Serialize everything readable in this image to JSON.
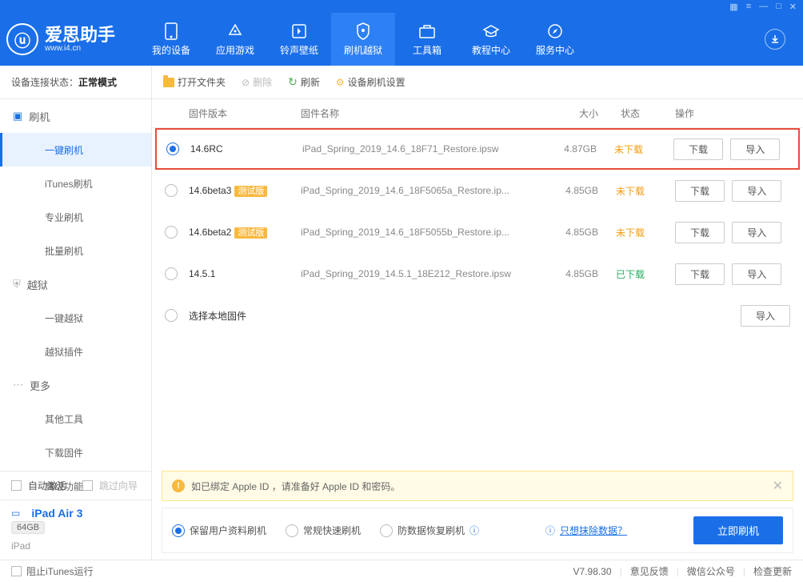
{
  "logo": {
    "title": "爱思助手",
    "sub": "www.i4.cn"
  },
  "nav": [
    {
      "label": "我的设备"
    },
    {
      "label": "应用游戏"
    },
    {
      "label": "铃声壁纸"
    },
    {
      "label": "刷机越狱"
    },
    {
      "label": "工具箱"
    },
    {
      "label": "教程中心"
    },
    {
      "label": "服务中心"
    }
  ],
  "status": {
    "label": "设备连接状态：",
    "value": "正常模式"
  },
  "toolbar": {
    "open_folder": "打开文件夹",
    "delete": "删除",
    "refresh": "刷新",
    "settings": "设备刷机设置"
  },
  "sidebar": {
    "flash": "刷机",
    "items_flash": [
      "一键刷机",
      "iTunes刷机",
      "专业刷机",
      "批量刷机"
    ],
    "jailbreak": "越狱",
    "items_jb": [
      "一键越狱",
      "越狱插件"
    ],
    "more": "更多",
    "items_more": [
      "其他工具",
      "下载固件",
      "高级功能"
    ],
    "auto_activate": "自动激活",
    "skip_wizard": "跳过向导",
    "device": "iPad Air 3",
    "storage": "64GB",
    "device_type": "iPad"
  },
  "table": {
    "headers": {
      "version": "固件版本",
      "name": "固件名称",
      "size": "大小",
      "status": "状态",
      "action": "操作"
    },
    "rows": [
      {
        "version": "14.6RC",
        "name": "iPad_Spring_2019_14.6_18F71_Restore.ipsw",
        "size": "4.87GB",
        "status": "未下载",
        "beta": false,
        "selected": true,
        "downloaded": false
      },
      {
        "version": "14.6beta3",
        "name": "iPad_Spring_2019_14.6_18F5065a_Restore.ip...",
        "size": "4.85GB",
        "status": "未下载",
        "beta": true,
        "selected": false,
        "downloaded": false
      },
      {
        "version": "14.6beta2",
        "name": "iPad_Spring_2019_14.6_18F5055b_Restore.ip...",
        "size": "4.85GB",
        "status": "未下载",
        "beta": true,
        "selected": false,
        "downloaded": false
      },
      {
        "version": "14.5.1",
        "name": "iPad_Spring_2019_14.5.1_18E212_Restore.ipsw",
        "size": "4.85GB",
        "status": "已下载",
        "beta": false,
        "selected": false,
        "downloaded": true
      }
    ],
    "local_fw": "选择本地固件",
    "beta_tag": "测试版",
    "btn_download": "下载",
    "btn_import": "导入"
  },
  "notice": "如已绑定 Apple ID ，请准备好 Apple ID 和密码。",
  "flash_options": {
    "keep_data": "保留用户资料刷机",
    "normal": "常规快速刷机",
    "anti_recovery": "防数据恢复刷机",
    "erase_link": "只想抹除数据？",
    "flash_now": "立即刷机"
  },
  "statusbar": {
    "block_itunes": "阻止iTunes运行",
    "version": "V7.98.30",
    "feedback": "意见反馈",
    "wechat": "微信公众号",
    "check_update": "检查更新"
  }
}
